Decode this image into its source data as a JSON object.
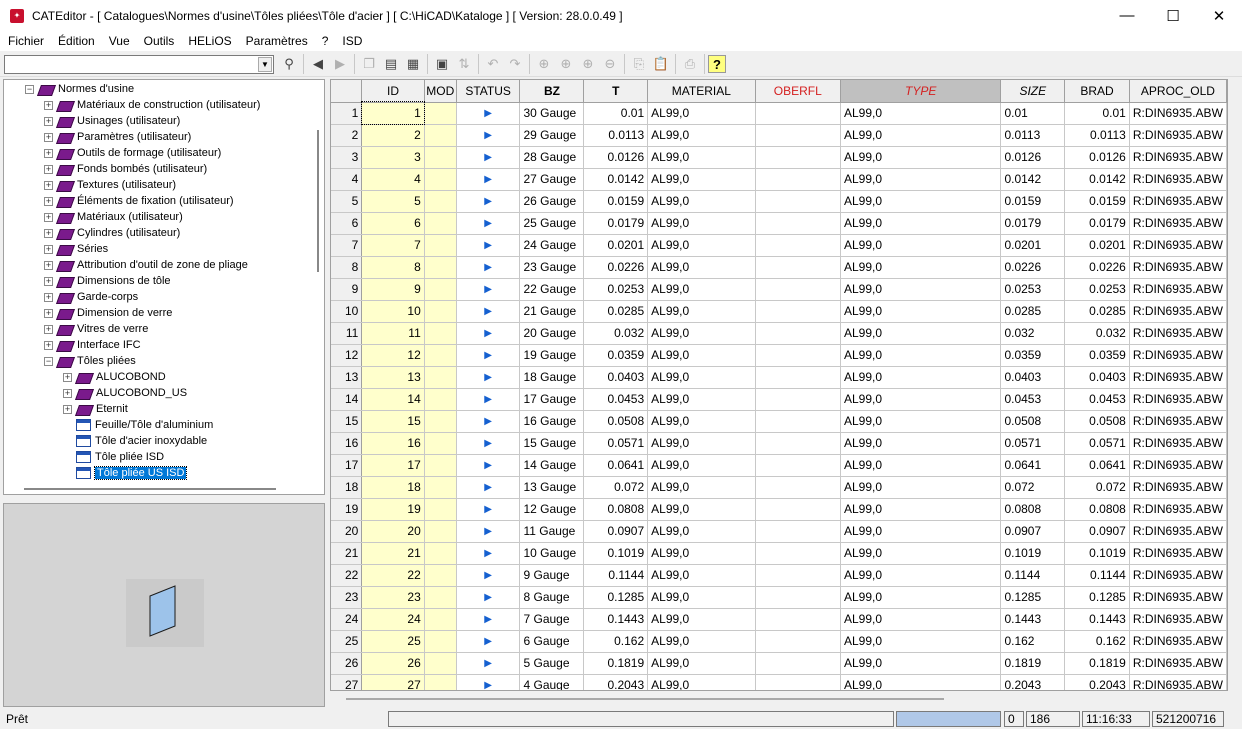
{
  "titlebar": {
    "title": "CATEditor - [ Catalogues\\Normes d'usine\\Tôles pliées\\Tôle d'acier ]    [ C:\\HiCAD\\Kataloge ]  [ Version: 28.0.0.49 ]"
  },
  "menu": [
    "Fichier",
    "Édition",
    "Vue",
    "Outils",
    "HELiOS",
    "Paramètres",
    "?",
    "ISD"
  ],
  "tree": {
    "root": "Normes d'usine",
    "items": [
      {
        "label": "Matériaux de construction (utilisateur)",
        "level": 1,
        "type": "book",
        "exp": true
      },
      {
        "label": "Usinages (utilisateur)",
        "level": 1,
        "type": "book",
        "exp": true
      },
      {
        "label": "Paramètres (utilisateur)",
        "level": 1,
        "type": "book",
        "exp": true
      },
      {
        "label": "Outils de formage (utilisateur)",
        "level": 1,
        "type": "book",
        "exp": true
      },
      {
        "label": "Fonds bombés (utilisateur)",
        "level": 1,
        "type": "book",
        "exp": true
      },
      {
        "label": "Textures (utilisateur)",
        "level": 1,
        "type": "book",
        "exp": true
      },
      {
        "label": "Éléments de fixation (utilisateur)",
        "level": 1,
        "type": "book",
        "exp": true
      },
      {
        "label": "Matériaux (utilisateur)",
        "level": 1,
        "type": "book",
        "exp": true
      },
      {
        "label": "Cylindres (utilisateur)",
        "level": 1,
        "type": "book",
        "exp": true
      },
      {
        "label": "Séries",
        "level": 1,
        "type": "book",
        "exp": true
      },
      {
        "label": "Attribution d'outil de zone de pliage",
        "level": 1,
        "type": "book",
        "exp": true
      },
      {
        "label": "Dimensions de tôle",
        "level": 1,
        "type": "book",
        "exp": true
      },
      {
        "label": "Garde-corps",
        "level": 1,
        "type": "book",
        "exp": true
      },
      {
        "label": "Dimension de verre",
        "level": 1,
        "type": "book",
        "exp": true
      },
      {
        "label": "Vitres de verre",
        "level": 1,
        "type": "book",
        "exp": true
      },
      {
        "label": "Interface IFC",
        "level": 1,
        "type": "book",
        "exp": true
      },
      {
        "label": "Tôles pliées",
        "level": 1,
        "type": "book",
        "exp": true
      },
      {
        "label": "ALUCOBOND",
        "level": 2,
        "type": "book",
        "exp": true
      },
      {
        "label": "ALUCOBOND_US",
        "level": 2,
        "type": "book",
        "exp": true
      },
      {
        "label": "Eternit",
        "level": 2,
        "type": "book",
        "exp": true
      },
      {
        "label": "Feuille/Tôle d'aluminium",
        "level": 2,
        "type": "table",
        "exp": false
      },
      {
        "label": "Tôle d'acier inoxydable",
        "level": 2,
        "type": "table",
        "exp": false
      },
      {
        "label": "Tôle pliée ISD",
        "level": 2,
        "type": "table",
        "exp": false
      },
      {
        "label": "Tôle pliée US ISD",
        "level": 2,
        "type": "table",
        "exp": false,
        "selected": true
      }
    ]
  },
  "grid": {
    "columns": [
      "",
      "ID",
      "MOD",
      "STATUS",
      "BZ",
      "T",
      "MATERIAL",
      "OBERFL",
      "TYPE",
      "SIZE",
      "BRAD",
      "APROC_OLD"
    ],
    "rows": [
      [
        "1",
        "1",
        "",
        "▶",
        "30 Gauge",
        "0.01",
        "AL99,0",
        "",
        "AL99,0",
        "0.01",
        "0.01",
        "R:DIN6935.ABW"
      ],
      [
        "2",
        "2",
        "",
        "▶",
        "29 Gauge",
        "0.0113",
        "AL99,0",
        "",
        "AL99,0",
        "0.0113",
        "0.0113",
        "R:DIN6935.ABW"
      ],
      [
        "3",
        "3",
        "",
        "▶",
        "28 Gauge",
        "0.0126",
        "AL99,0",
        "",
        "AL99,0",
        "0.0126",
        "0.0126",
        "R:DIN6935.ABW"
      ],
      [
        "4",
        "4",
        "",
        "▶",
        "27 Gauge",
        "0.0142",
        "AL99,0",
        "",
        "AL99,0",
        "0.0142",
        "0.0142",
        "R:DIN6935.ABW"
      ],
      [
        "5",
        "5",
        "",
        "▶",
        "26 Gauge",
        "0.0159",
        "AL99,0",
        "",
        "AL99,0",
        "0.0159",
        "0.0159",
        "R:DIN6935.ABW"
      ],
      [
        "6",
        "6",
        "",
        "▶",
        "25 Gauge",
        "0.0179",
        "AL99,0",
        "",
        "AL99,0",
        "0.0179",
        "0.0179",
        "R:DIN6935.ABW"
      ],
      [
        "7",
        "7",
        "",
        "▶",
        "24 Gauge",
        "0.0201",
        "AL99,0",
        "",
        "AL99,0",
        "0.0201",
        "0.0201",
        "R:DIN6935.ABW"
      ],
      [
        "8",
        "8",
        "",
        "▶",
        "23 Gauge",
        "0.0226",
        "AL99,0",
        "",
        "AL99,0",
        "0.0226",
        "0.0226",
        "R:DIN6935.ABW"
      ],
      [
        "9",
        "9",
        "",
        "▶",
        "22 Gauge",
        "0.0253",
        "AL99,0",
        "",
        "AL99,0",
        "0.0253",
        "0.0253",
        "R:DIN6935.ABW"
      ],
      [
        "10",
        "10",
        "",
        "▶",
        "21 Gauge",
        "0.0285",
        "AL99,0",
        "",
        "AL99,0",
        "0.0285",
        "0.0285",
        "R:DIN6935.ABW"
      ],
      [
        "11",
        "11",
        "",
        "▶",
        "20 Gauge",
        "0.032",
        "AL99,0",
        "",
        "AL99,0",
        "0.032",
        "0.032",
        "R:DIN6935.ABW"
      ],
      [
        "12",
        "12",
        "",
        "▶",
        "19 Gauge",
        "0.0359",
        "AL99,0",
        "",
        "AL99,0",
        "0.0359",
        "0.0359",
        "R:DIN6935.ABW"
      ],
      [
        "13",
        "13",
        "",
        "▶",
        "18 Gauge",
        "0.0403",
        "AL99,0",
        "",
        "AL99,0",
        "0.0403",
        "0.0403",
        "R:DIN6935.ABW"
      ],
      [
        "14",
        "14",
        "",
        "▶",
        "17 Gauge",
        "0.0453",
        "AL99,0",
        "",
        "AL99,0",
        "0.0453",
        "0.0453",
        "R:DIN6935.ABW"
      ],
      [
        "15",
        "15",
        "",
        "▶",
        "16 Gauge",
        "0.0508",
        "AL99,0",
        "",
        "AL99,0",
        "0.0508",
        "0.0508",
        "R:DIN6935.ABW"
      ],
      [
        "16",
        "16",
        "",
        "▶",
        "15 Gauge",
        "0.0571",
        "AL99,0",
        "",
        "AL99,0",
        "0.0571",
        "0.0571",
        "R:DIN6935.ABW"
      ],
      [
        "17",
        "17",
        "",
        "▶",
        "14 Gauge",
        "0.0641",
        "AL99,0",
        "",
        "AL99,0",
        "0.0641",
        "0.0641",
        "R:DIN6935.ABW"
      ],
      [
        "18",
        "18",
        "",
        "▶",
        "13 Gauge",
        "0.072",
        "AL99,0",
        "",
        "AL99,0",
        "0.072",
        "0.072",
        "R:DIN6935.ABW"
      ],
      [
        "19",
        "19",
        "",
        "▶",
        "12 Gauge",
        "0.0808",
        "AL99,0",
        "",
        "AL99,0",
        "0.0808",
        "0.0808",
        "R:DIN6935.ABW"
      ],
      [
        "20",
        "20",
        "",
        "▶",
        "11 Gauge",
        "0.0907",
        "AL99,0",
        "",
        "AL99,0",
        "0.0907",
        "0.0907",
        "R:DIN6935.ABW"
      ],
      [
        "21",
        "21",
        "",
        "▶",
        "10 Gauge",
        "0.1019",
        "AL99,0",
        "",
        "AL99,0",
        "0.1019",
        "0.1019",
        "R:DIN6935.ABW"
      ],
      [
        "22",
        "22",
        "",
        "▶",
        "9 Gauge",
        "0.1144",
        "AL99,0",
        "",
        "AL99,0",
        "0.1144",
        "0.1144",
        "R:DIN6935.ABW"
      ],
      [
        "23",
        "23",
        "",
        "▶",
        "8 Gauge",
        "0.1285",
        "AL99,0",
        "",
        "AL99,0",
        "0.1285",
        "0.1285",
        "R:DIN6935.ABW"
      ],
      [
        "24",
        "24",
        "",
        "▶",
        "7 Gauge",
        "0.1443",
        "AL99,0",
        "",
        "AL99,0",
        "0.1443",
        "0.1443",
        "R:DIN6935.ABW"
      ],
      [
        "25",
        "25",
        "",
        "▶",
        "6 Gauge",
        "0.162",
        "AL99,0",
        "",
        "AL99,0",
        "0.162",
        "0.162",
        "R:DIN6935.ABW"
      ],
      [
        "26",
        "26",
        "",
        "▶",
        "5 Gauge",
        "0.1819",
        "AL99,0",
        "",
        "AL99,0",
        "0.1819",
        "0.1819",
        "R:DIN6935.ABW"
      ],
      [
        "27",
        "27",
        "",
        "▶",
        "4 Gauge",
        "0.2043",
        "AL99,0",
        "",
        "AL99,0",
        "0.2043",
        "0.2043",
        "R:DIN6935.ABW"
      ]
    ]
  },
  "statusbar": {
    "text": "Prêt",
    "count": "0",
    "rows": "186",
    "time": "11:16:33",
    "id": "521200716"
  }
}
